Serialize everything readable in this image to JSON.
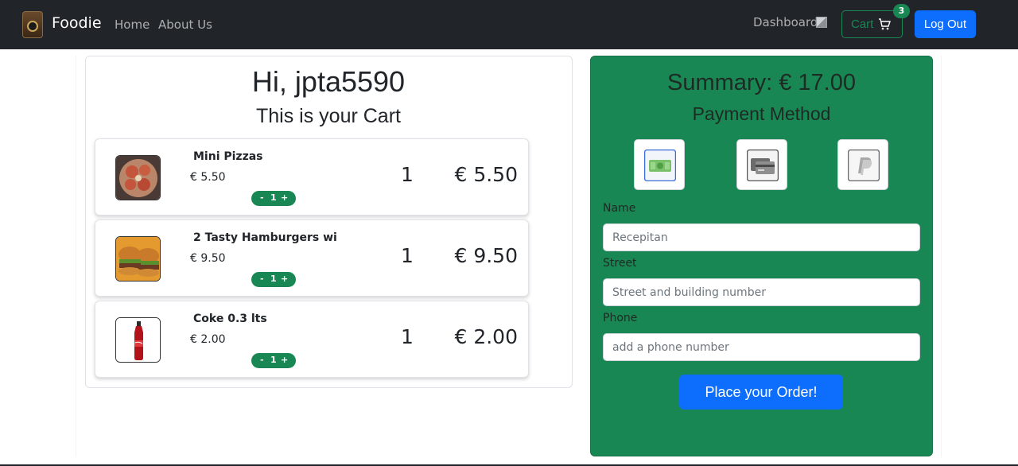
{
  "navbar": {
    "brand": "Foodie",
    "links": [
      "Home",
      "About Us"
    ],
    "dashboard": "Dashboard",
    "cart_label": "Cart",
    "cart_count": "3",
    "logout": "Log Out"
  },
  "cart": {
    "greeting": "Hi, jpta5590",
    "title": "This is your Cart",
    "items": [
      {
        "name": "Mini Pizzas",
        "price": "€ 5.50",
        "stepper_minus": "-",
        "stepper_value": "1",
        "stepper_plus": "+",
        "qty": "1",
        "total": "€ 5.50",
        "image_icon": "pizza-image"
      },
      {
        "name": "2 Tasty Hamburgers wi",
        "price": "€ 9.50",
        "stepper_minus": "-",
        "stepper_value": "1",
        "stepper_plus": "+",
        "qty": "1",
        "total": "€ 9.50",
        "image_icon": "burger-image"
      },
      {
        "name": "Coke 0.3 lts",
        "price": "€ 2.00",
        "stepper_minus": "-",
        "stepper_value": "1",
        "stepper_plus": "+",
        "qty": "1",
        "total": "€ 2.00",
        "image_icon": "coke-bottle-image"
      }
    ]
  },
  "summary": {
    "title": "Summary: € 17.00",
    "payment_title": "Payment Method",
    "payment_options": [
      "cash-icon",
      "credit-card-icon",
      "paypal-icon"
    ],
    "fields": [
      {
        "label": "Name",
        "placeholder": "Recepitan"
      },
      {
        "label": "Street",
        "placeholder": "Street and building number"
      },
      {
        "label": "Phone",
        "placeholder": "add a phone number"
      }
    ],
    "submit": "Place your Order!"
  },
  "colors": {
    "navbar": "#212529",
    "success": "#198754",
    "primary": "#0d6efd"
  }
}
